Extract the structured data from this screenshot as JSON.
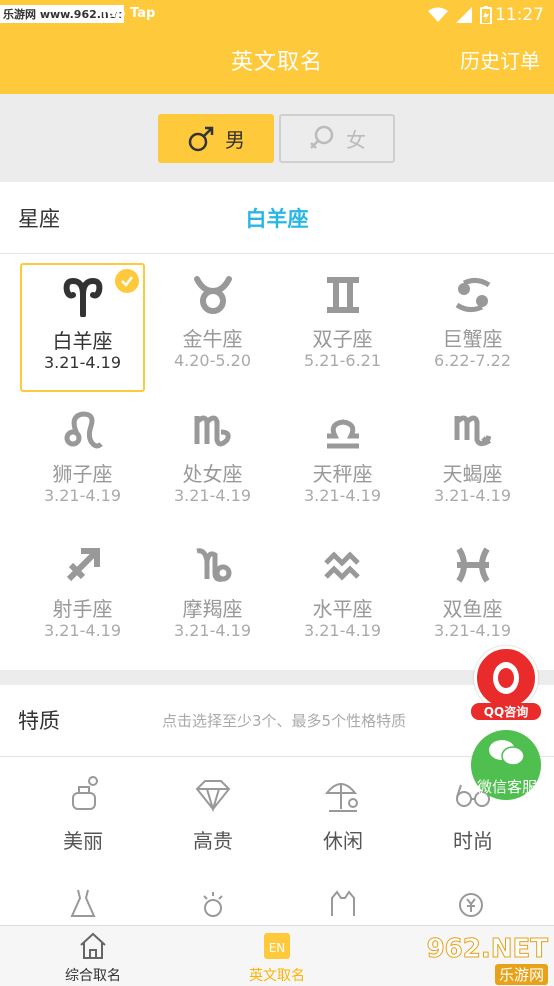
{
  "status_bar": {
    "watermark": "乐游网 www.962.net",
    "tap1": "Tap",
    "tap2": "Tap",
    "time": "11:27"
  },
  "header": {
    "title": "英文取名",
    "history": "历史订单"
  },
  "gender": {
    "male_label": "男",
    "female_label": "女",
    "selected": "male"
  },
  "zodiac": {
    "section_label": "星座",
    "selected_name": "白羊座",
    "items": [
      {
        "name": "白羊座",
        "date": "3.21-4.19",
        "icon": "aries-icon",
        "selected": true
      },
      {
        "name": "金牛座",
        "date": "4.20-5.20",
        "icon": "taurus-icon"
      },
      {
        "name": "双子座",
        "date": "5.21-6.21",
        "icon": "gemini-icon"
      },
      {
        "name": "巨蟹座",
        "date": "6.22-7.22",
        "icon": "cancer-icon"
      },
      {
        "name": "狮子座",
        "date": "3.21-4.19",
        "icon": "leo-icon"
      },
      {
        "name": "处女座",
        "date": "3.21-4.19",
        "icon": "virgo-icon"
      },
      {
        "name": "天秤座",
        "date": "3.21-4.19",
        "icon": "libra-icon"
      },
      {
        "name": "天蝎座",
        "date": "3.21-4.19",
        "icon": "scorpio-icon"
      },
      {
        "name": "射手座",
        "date": "3.21-4.19",
        "icon": "sagittarius-icon"
      },
      {
        "name": "摩羯座",
        "date": "3.21-4.19",
        "icon": "capricorn-icon"
      },
      {
        "name": "水平座",
        "date": "3.21-4.19",
        "icon": "aquarius-icon"
      },
      {
        "name": "双鱼座",
        "date": "3.21-4.19",
        "icon": "pisces-icon"
      }
    ]
  },
  "traits": {
    "section_label": "特质",
    "hint": "点击选择至少3个、最多5个性格特质",
    "items": [
      {
        "label": "美丽",
        "icon": "perfume-icon"
      },
      {
        "label": "高贵",
        "icon": "diamond-icon"
      },
      {
        "label": "休闲",
        "icon": "beach-umbrella-icon"
      },
      {
        "label": "时尚",
        "icon": "glasses-icon"
      }
    ]
  },
  "floating": {
    "qq_label": "QQ咨询",
    "wechat_label": "微信客服"
  },
  "bottom_nav": {
    "items": [
      {
        "label": "综合取名",
        "icon": "home-icon"
      },
      {
        "label": "英文取名",
        "icon": "en-icon",
        "active": true
      }
    ],
    "watermark_logo": "962.NET",
    "watermark_sub": "乐游网"
  },
  "colors": {
    "accent": "#ffc93c",
    "selected_text": "#27b7e5",
    "qq_red": "#ea2b2b",
    "wechat_green": "#4fbf4f"
  }
}
